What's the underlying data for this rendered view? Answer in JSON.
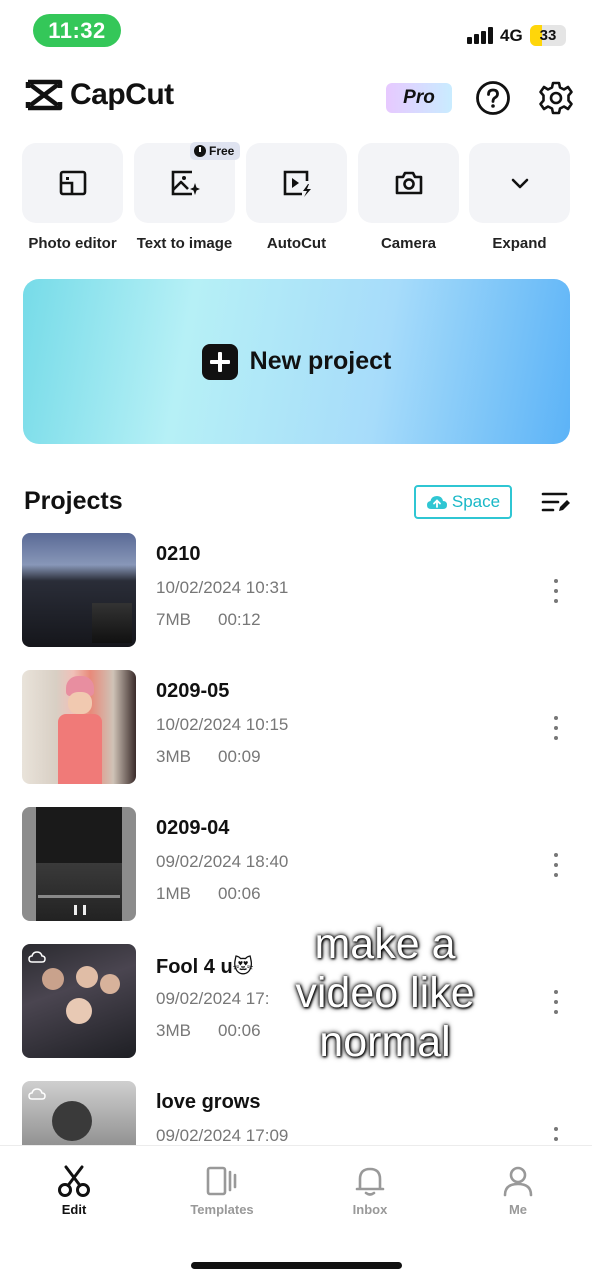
{
  "status_bar": {
    "time": "11:32",
    "network": "4G",
    "battery": "33",
    "battery_level": 0.33
  },
  "header": {
    "app_name": "CapCut",
    "pro_label": "Pro"
  },
  "tools": [
    {
      "label": "Photo editor",
      "icon": "photo-editor-icon"
    },
    {
      "label": "Text to image",
      "icon": "text-to-image-icon",
      "badge": "Free"
    },
    {
      "label": "AutoCut",
      "icon": "autocut-icon"
    },
    {
      "label": "Camera",
      "icon": "camera-icon"
    },
    {
      "label": "Expand",
      "icon": "chevron-down-icon"
    }
  ],
  "new_project": {
    "label": "New project"
  },
  "projects_section": {
    "title": "Projects",
    "space_label": "Space"
  },
  "projects": [
    {
      "name": "0210",
      "date": "10/02/2024 10:31",
      "size": "7MB",
      "duration": "00:12"
    },
    {
      "name": "0209-05",
      "date": "10/02/2024 10:15",
      "size": "3MB",
      "duration": "00:09"
    },
    {
      "name": "0209-04",
      "date": "09/02/2024 18:40",
      "size": "1MB",
      "duration": "00:06"
    },
    {
      "name": "Fool 4 u😻",
      "date": "09/02/2024 17:",
      "size": "3MB",
      "duration": "00:06"
    },
    {
      "name": "love grows",
      "date": "09/02/2024 17:09",
      "size": "",
      "duration": ""
    }
  ],
  "overlay_caption": "make a video like normal",
  "nav": [
    {
      "label": "Edit",
      "icon": "scissors-icon",
      "active": true
    },
    {
      "label": "Templates",
      "icon": "templates-icon",
      "active": false
    },
    {
      "label": "Inbox",
      "icon": "bell-icon",
      "active": false
    },
    {
      "label": "Me",
      "icon": "person-icon",
      "active": false
    }
  ],
  "colors": {
    "accent": "#19b8c7",
    "status_green": "#34c759",
    "battery_yellow": "#ffd60a"
  }
}
